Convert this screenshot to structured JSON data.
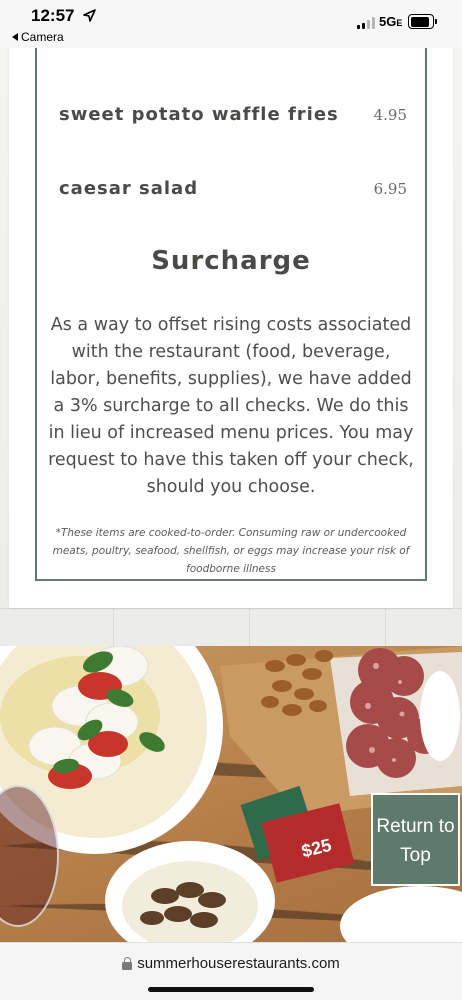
{
  "status_bar": {
    "time": "12:57",
    "back_label": "Camera",
    "network": "5G",
    "network_suffix": "E"
  },
  "menu": {
    "items": [
      {
        "name": "sweet potato waffle fries",
        "price": "4.95"
      },
      {
        "name": "caesar salad",
        "price": "6.95"
      }
    ],
    "surcharge_title": "Surcharge",
    "surcharge_lines": [
      "As a way to offset rising costs associated",
      "with the restaurant (food, beverage,",
      "labor, benefits, supplies), we have added",
      "a 3% surcharge to all checks. We do this",
      "in lieu of increased menu prices. You may",
      "request to have this taken off your check,",
      "should you choose."
    ],
    "disclaimer_lines": [
      "*These items are cooked-to-order. Consuming raw or undercooked",
      "meats, poultry, seafood, shellfish, or eggs may increase your risk of",
      "foodborne illness"
    ]
  },
  "photo": {
    "gift_card_amount": "$25"
  },
  "return_to_top": {
    "line1": "Return to",
    "line2": "Top"
  },
  "browser": {
    "url": "summerhouserestaurants.com"
  },
  "colors": {
    "accent_green": "#5e7a6c",
    "text_dark": "#4a4a48"
  }
}
